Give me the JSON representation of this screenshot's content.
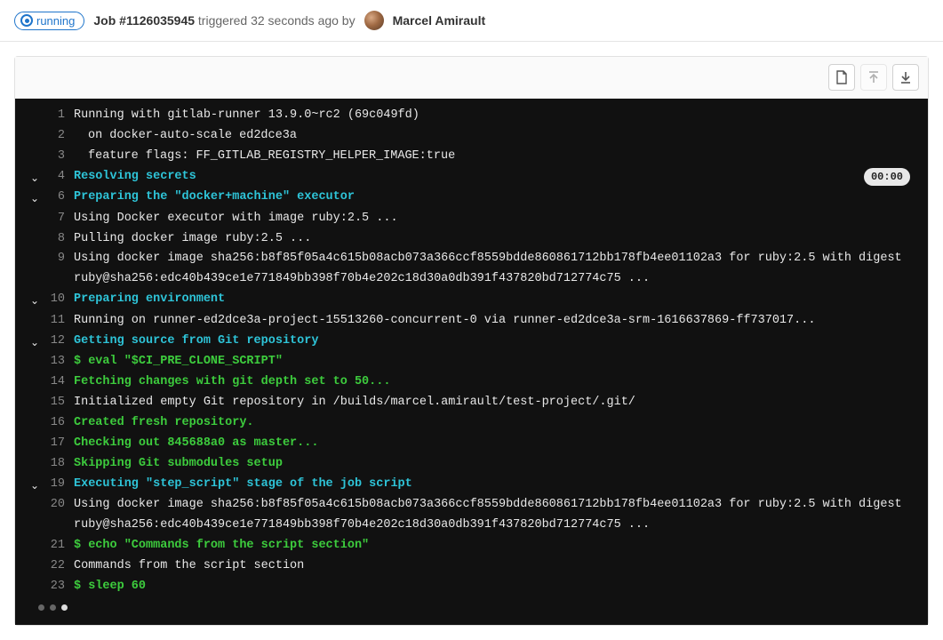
{
  "header": {
    "status": "running",
    "job_label": "Job #1126035945",
    "triggered_text": "triggered 32 seconds ago by",
    "user_name": "Marcel Amirault"
  },
  "toolbar": {
    "raw_btn": "Show raw",
    "scroll_top_btn": "Scroll to top",
    "scroll_bottom_btn": "Scroll to bottom"
  },
  "log": {
    "lines": [
      {
        "n": 1,
        "cls": "c-white",
        "collapsible": false,
        "text": "Running with gitlab-runner 13.9.0~rc2 (69c049fd)"
      },
      {
        "n": 2,
        "cls": "c-white",
        "collapsible": false,
        "indent": true,
        "text": "on docker-auto-scale ed2dce3a"
      },
      {
        "n": 3,
        "cls": "c-white",
        "collapsible": false,
        "indent": true,
        "text": "feature flags: FF_GITLAB_REGISTRY_HELPER_IMAGE:true"
      },
      {
        "n": 4,
        "cls": "c-cyan",
        "collapsible": true,
        "text": "Resolving secrets",
        "duration": "00:00"
      },
      {
        "n": 6,
        "cls": "c-cyan",
        "collapsible": true,
        "text": "Preparing the \"docker+machine\" executor"
      },
      {
        "n": 7,
        "cls": "c-white",
        "collapsible": false,
        "text": "Using Docker executor with image ruby:2.5 ..."
      },
      {
        "n": 8,
        "cls": "c-white",
        "collapsible": false,
        "text": "Pulling docker image ruby:2.5 ..."
      },
      {
        "n": 9,
        "cls": "c-white",
        "collapsible": false,
        "text": "Using docker image sha256:b8f85f05a4c615b08acb073a366ccf8559bdde860861712bb178fb4ee01102a3 for ruby:2.5 with digest ruby@sha256:edc40b439ce1e771849bb398f70b4e202c18d30a0db391f437820bd712774c75 ..."
      },
      {
        "n": 10,
        "cls": "c-cyan",
        "collapsible": true,
        "text": "Preparing environment"
      },
      {
        "n": 11,
        "cls": "c-white",
        "collapsible": false,
        "text": "Running on runner-ed2dce3a-project-15513260-concurrent-0 via runner-ed2dce3a-srm-1616637869-ff737017..."
      },
      {
        "n": 12,
        "cls": "c-cyan",
        "collapsible": true,
        "text": "Getting source from Git repository"
      },
      {
        "n": 13,
        "cls": "c-green",
        "collapsible": false,
        "text": "$ eval \"$CI_PRE_CLONE_SCRIPT\""
      },
      {
        "n": 14,
        "cls": "c-green",
        "collapsible": false,
        "text": "Fetching changes with git depth set to 50..."
      },
      {
        "n": 15,
        "cls": "c-white",
        "collapsible": false,
        "text": "Initialized empty Git repository in /builds/marcel.amirault/test-project/.git/"
      },
      {
        "n": 16,
        "cls": "c-green",
        "collapsible": false,
        "text": "Created fresh repository."
      },
      {
        "n": 17,
        "cls": "c-green",
        "collapsible": false,
        "text": "Checking out 845688a0 as master..."
      },
      {
        "n": 18,
        "cls": "c-green",
        "collapsible": false,
        "text": "Skipping Git submodules setup"
      },
      {
        "n": 19,
        "cls": "c-cyan",
        "collapsible": true,
        "text": "Executing \"step_script\" stage of the job script"
      },
      {
        "n": 20,
        "cls": "c-white",
        "collapsible": false,
        "text": "Using docker image sha256:b8f85f05a4c615b08acb073a366ccf8559bdde860861712bb178fb4ee01102a3 for ruby:2.5 with digest ruby@sha256:edc40b439ce1e771849bb398f70b4e202c18d30a0db391f437820bd712774c75 ..."
      },
      {
        "n": 21,
        "cls": "c-green",
        "collapsible": false,
        "text": "$ echo \"Commands from the script section\""
      },
      {
        "n": 22,
        "cls": "c-white",
        "collapsible": false,
        "text": "Commands from the script section"
      },
      {
        "n": 23,
        "cls": "c-green",
        "collapsible": false,
        "text": "$ sleep 60"
      }
    ]
  }
}
